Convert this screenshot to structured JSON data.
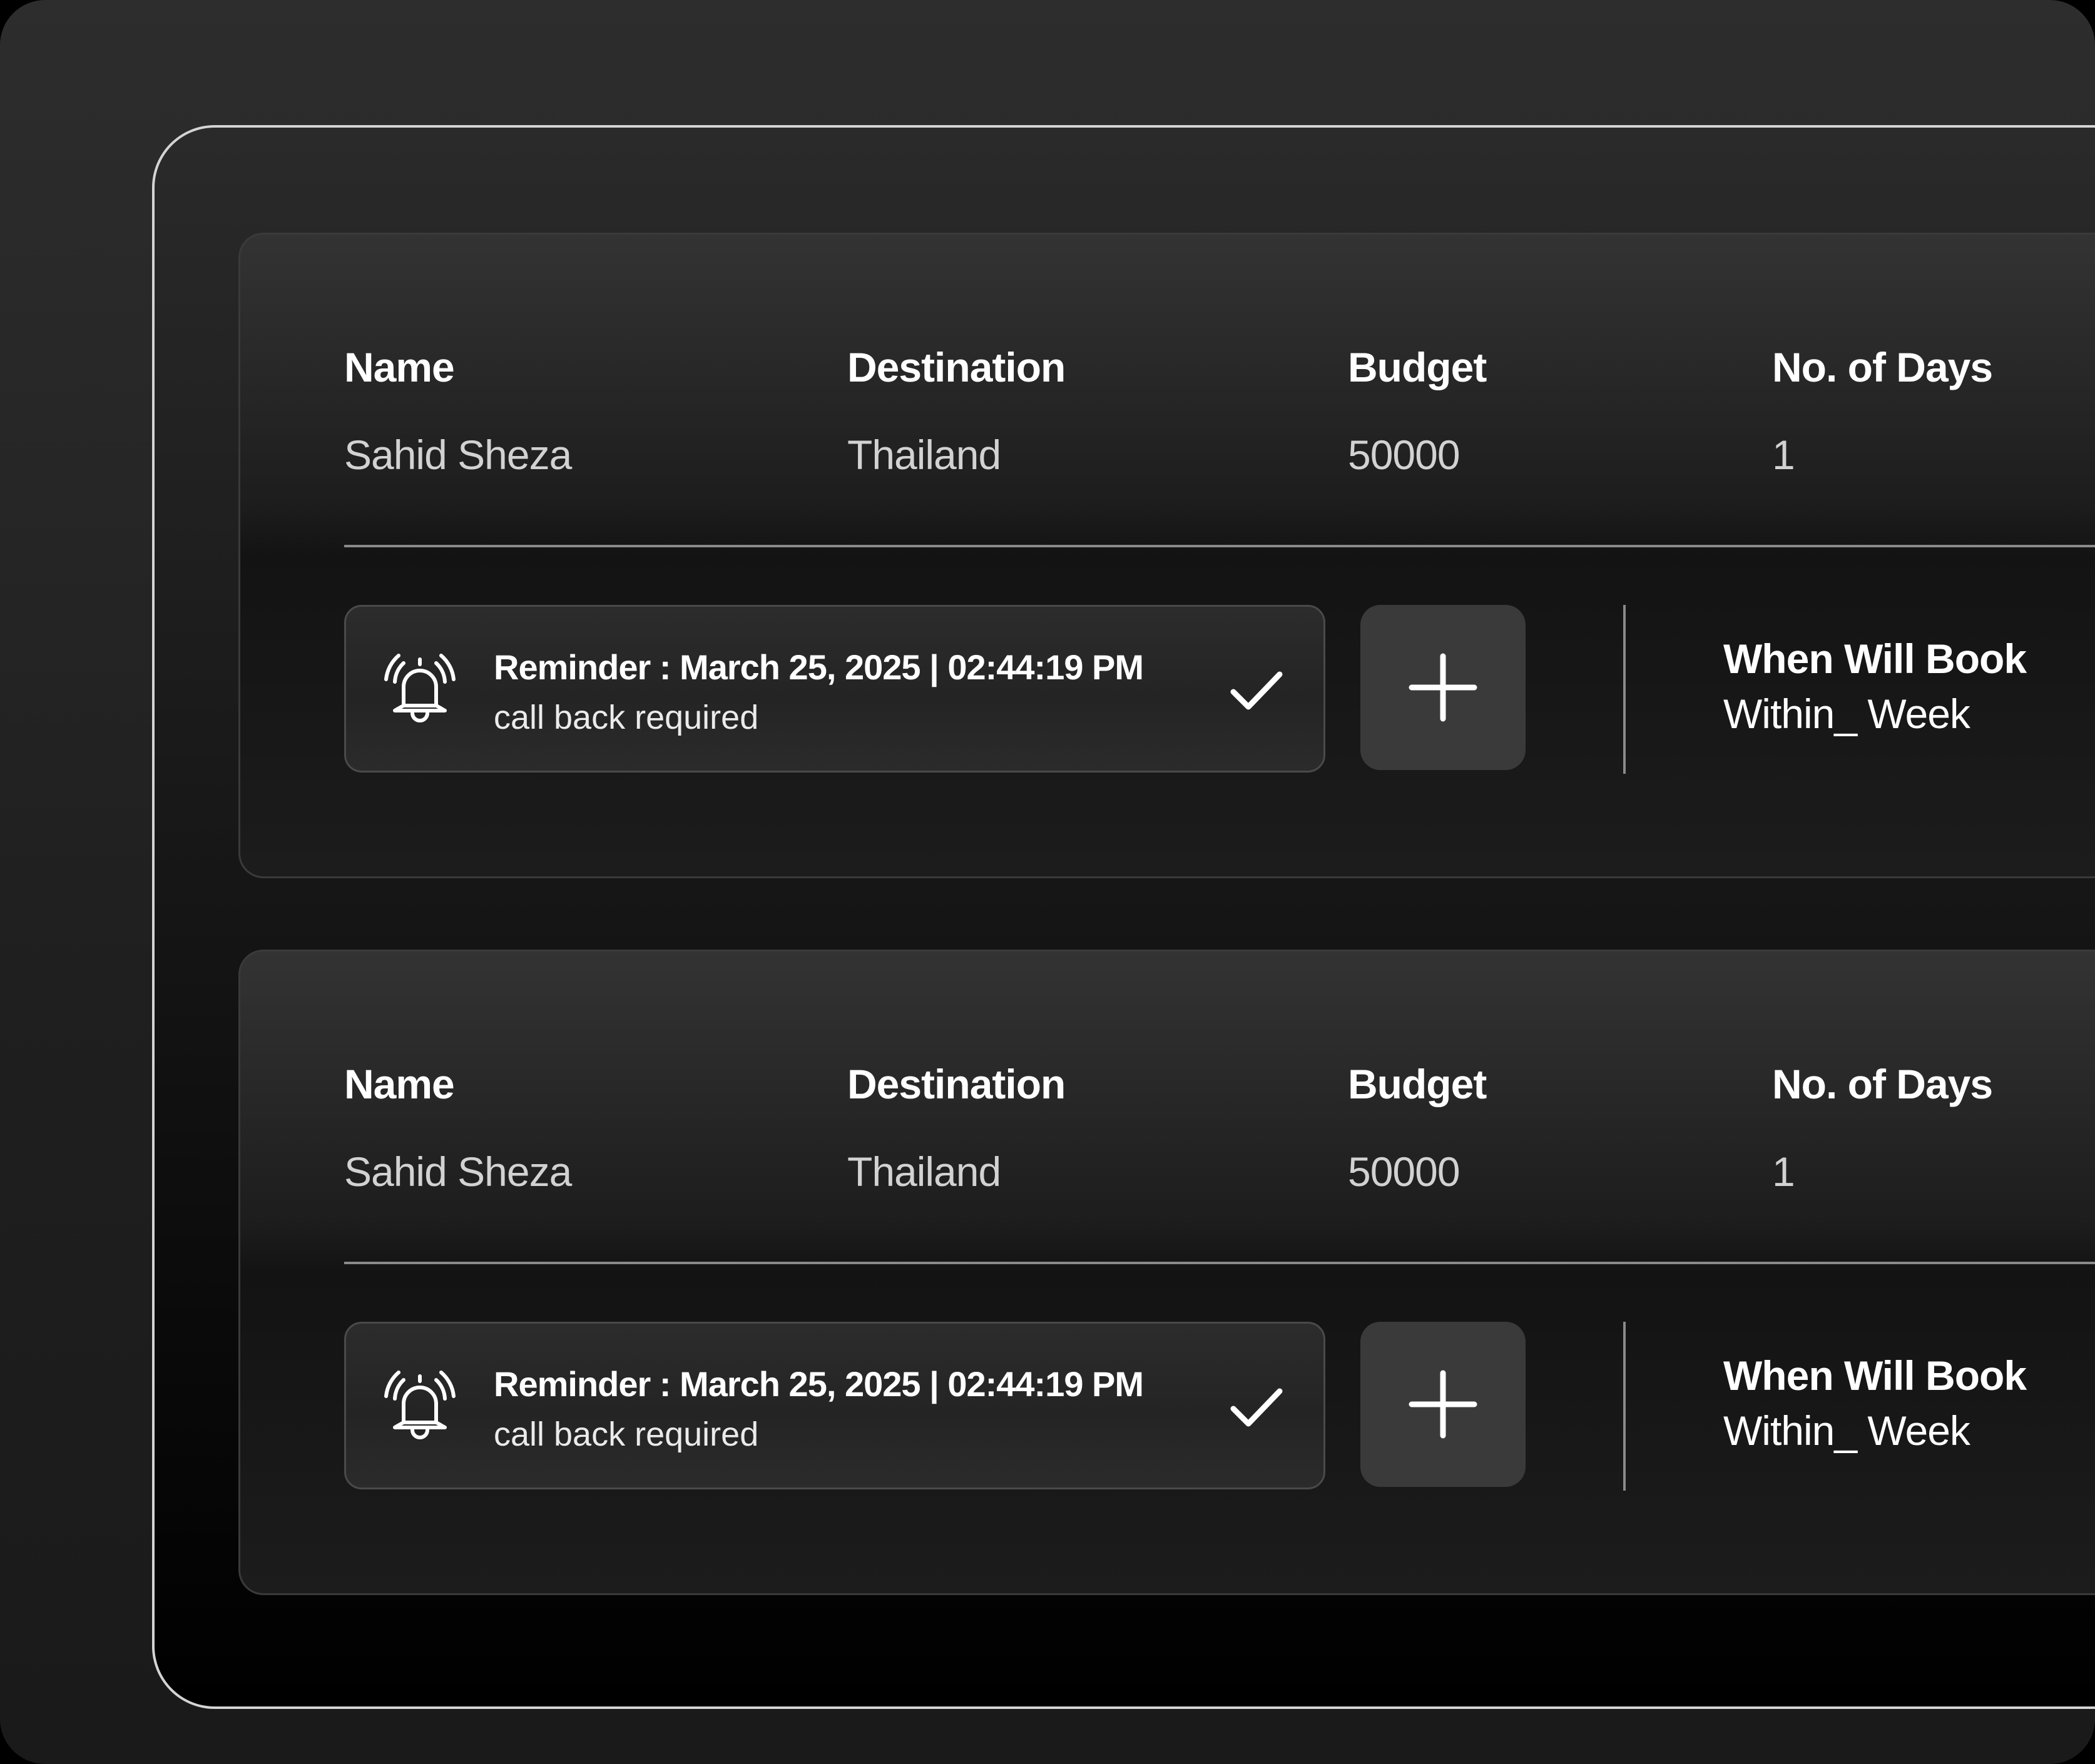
{
  "leads": [
    {
      "headers": {
        "name": "Name",
        "destination": "Destination",
        "budget": "Budget",
        "days": "No. of Days"
      },
      "values": {
        "name": "Sahid Sheza",
        "destination": "Thailand",
        "budget": "50000",
        "days": "1"
      },
      "reminder": {
        "title": "Reminder : March 25, 2025 | 02:44:19 PM",
        "note": "call back required",
        "icon": "bell-ringing-icon",
        "done_icon": "check-icon"
      },
      "add_icon": "plus-icon",
      "when_will_book": {
        "label": "When Will Book",
        "value": "Within_ Week"
      }
    },
    {
      "headers": {
        "name": "Name",
        "destination": "Destination",
        "budget": "Budget",
        "days": "No. of Days"
      },
      "values": {
        "name": "Sahid Sheza",
        "destination": "Thailand",
        "budget": "50000",
        "days": "1"
      },
      "reminder": {
        "title": "Reminder : March 25, 2025 | 02:44:19 PM",
        "note": "call back required",
        "icon": "bell-ringing-icon",
        "done_icon": "check-icon"
      },
      "add_icon": "plus-icon",
      "when_will_book": {
        "label": "When Will Book",
        "value": "Within_ Week"
      }
    }
  ],
  "colors": {
    "background": "#1f1f1f",
    "card": "#1d1d1d",
    "text_primary": "#ffffff",
    "text_secondary": "#d2d2d2",
    "button": "#3a3a3a",
    "divider": "#8a8a8a"
  }
}
